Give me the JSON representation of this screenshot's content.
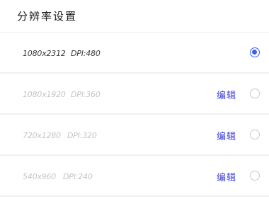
{
  "header": {
    "title": "分辨率设置"
  },
  "options": [
    {
      "resolution": "1080x2312",
      "dpi": "DPI:480",
      "edit_label": "",
      "selected": true
    },
    {
      "resolution": "1080x1920",
      "dpi": "DPI:360",
      "edit_label": "编辑",
      "selected": false
    },
    {
      "resolution": "720x1280",
      "dpi": "DPI:320",
      "edit_label": "编辑",
      "selected": false
    },
    {
      "resolution": "540x960",
      "dpi": "DPI:240",
      "edit_label": "编辑",
      "selected": false
    }
  ],
  "colors": {
    "accent": "#3d5ef0",
    "edit_link": "#3b3fd6",
    "disabled_text": "#c4c4c4"
  }
}
